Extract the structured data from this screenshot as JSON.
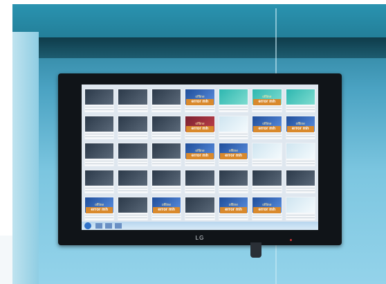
{
  "scene": {
    "tv_brand": "LG",
    "cells": [
      {
        "style": "dark",
        "status": ""
      },
      {
        "style": "dark",
        "status": ""
      },
      {
        "style": "dark",
        "status": ""
      },
      {
        "style": "blue",
        "status": "error"
      },
      {
        "style": "teal",
        "status": ""
      },
      {
        "style": "teal",
        "status": "error"
      },
      {
        "style": "teal",
        "status": ""
      },
      {
        "style": "dark",
        "status": ""
      },
      {
        "style": "dark",
        "status": ""
      },
      {
        "style": "dark",
        "status": ""
      },
      {
        "style": "red",
        "status": "error"
      },
      {
        "style": "light",
        "status": ""
      },
      {
        "style": "blue",
        "status": "error"
      },
      {
        "style": "blue",
        "status": "error"
      },
      {
        "style": "dark",
        "status": ""
      },
      {
        "style": "dark",
        "status": ""
      },
      {
        "style": "dark",
        "status": ""
      },
      {
        "style": "blue",
        "status": "error"
      },
      {
        "style": "blue",
        "status": "error"
      },
      {
        "style": "light",
        "status": ""
      },
      {
        "style": "light",
        "status": ""
      },
      {
        "style": "dark",
        "status": ""
      },
      {
        "style": "dark",
        "status": ""
      },
      {
        "style": "dark",
        "status": ""
      },
      {
        "style": "dark",
        "status": ""
      },
      {
        "style": "dark",
        "status": ""
      },
      {
        "style": "dark",
        "status": ""
      },
      {
        "style": "dark",
        "status": ""
      },
      {
        "style": "blue",
        "status": "error"
      },
      {
        "style": "dark",
        "status": ""
      },
      {
        "style": "blue",
        "status": "error"
      },
      {
        "style": "dark",
        "status": ""
      },
      {
        "style": "blue",
        "status": "error"
      },
      {
        "style": "blue",
        "status": "error"
      },
      {
        "style": "light",
        "status": ""
      }
    ],
    "error_label": "error mh",
    "offline_label": "offline"
  },
  "colors": {
    "error_bg": "#d9892c",
    "wall": "#7cc6e0",
    "bezel": "#101418"
  }
}
